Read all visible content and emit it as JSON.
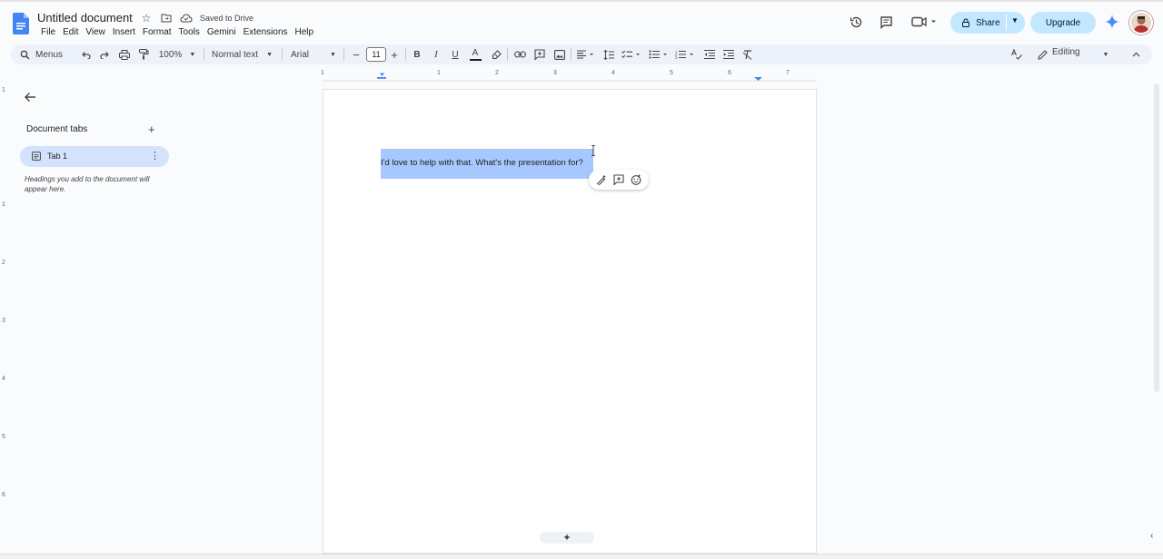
{
  "app": {
    "doc_title": "Untitled document",
    "saved_status": "Saved to Drive"
  },
  "menu": [
    "File",
    "Edit",
    "View",
    "Insert",
    "Format",
    "Tools",
    "Gemini",
    "Extensions",
    "Help"
  ],
  "header": {
    "share_label": "Share",
    "upgrade_label": "Upgrade"
  },
  "toolbar": {
    "menus_label": "Menus",
    "zoom": "100%",
    "style": "Normal text",
    "font": "Arial",
    "font_size": "11",
    "mode": "Editing"
  },
  "ruler": {
    "h": [
      "1",
      "1",
      "2",
      "3",
      "4",
      "5",
      "6",
      "7"
    ],
    "v": [
      "1",
      "1",
      "2",
      "3",
      "4",
      "5",
      "6"
    ]
  },
  "sidebar": {
    "section_title": "Document tabs",
    "tab_label": "Tab 1",
    "hint": "Headings you add to the document will appear here."
  },
  "document": {
    "selected_text": "I'd love to help with that. What's the presentation for?"
  },
  "colors": {
    "accent": "#c2e7ff",
    "selection": "#a6c8ff",
    "tab_active": "#d3e3fd",
    "toolbar_bg": "#edf2fa"
  }
}
